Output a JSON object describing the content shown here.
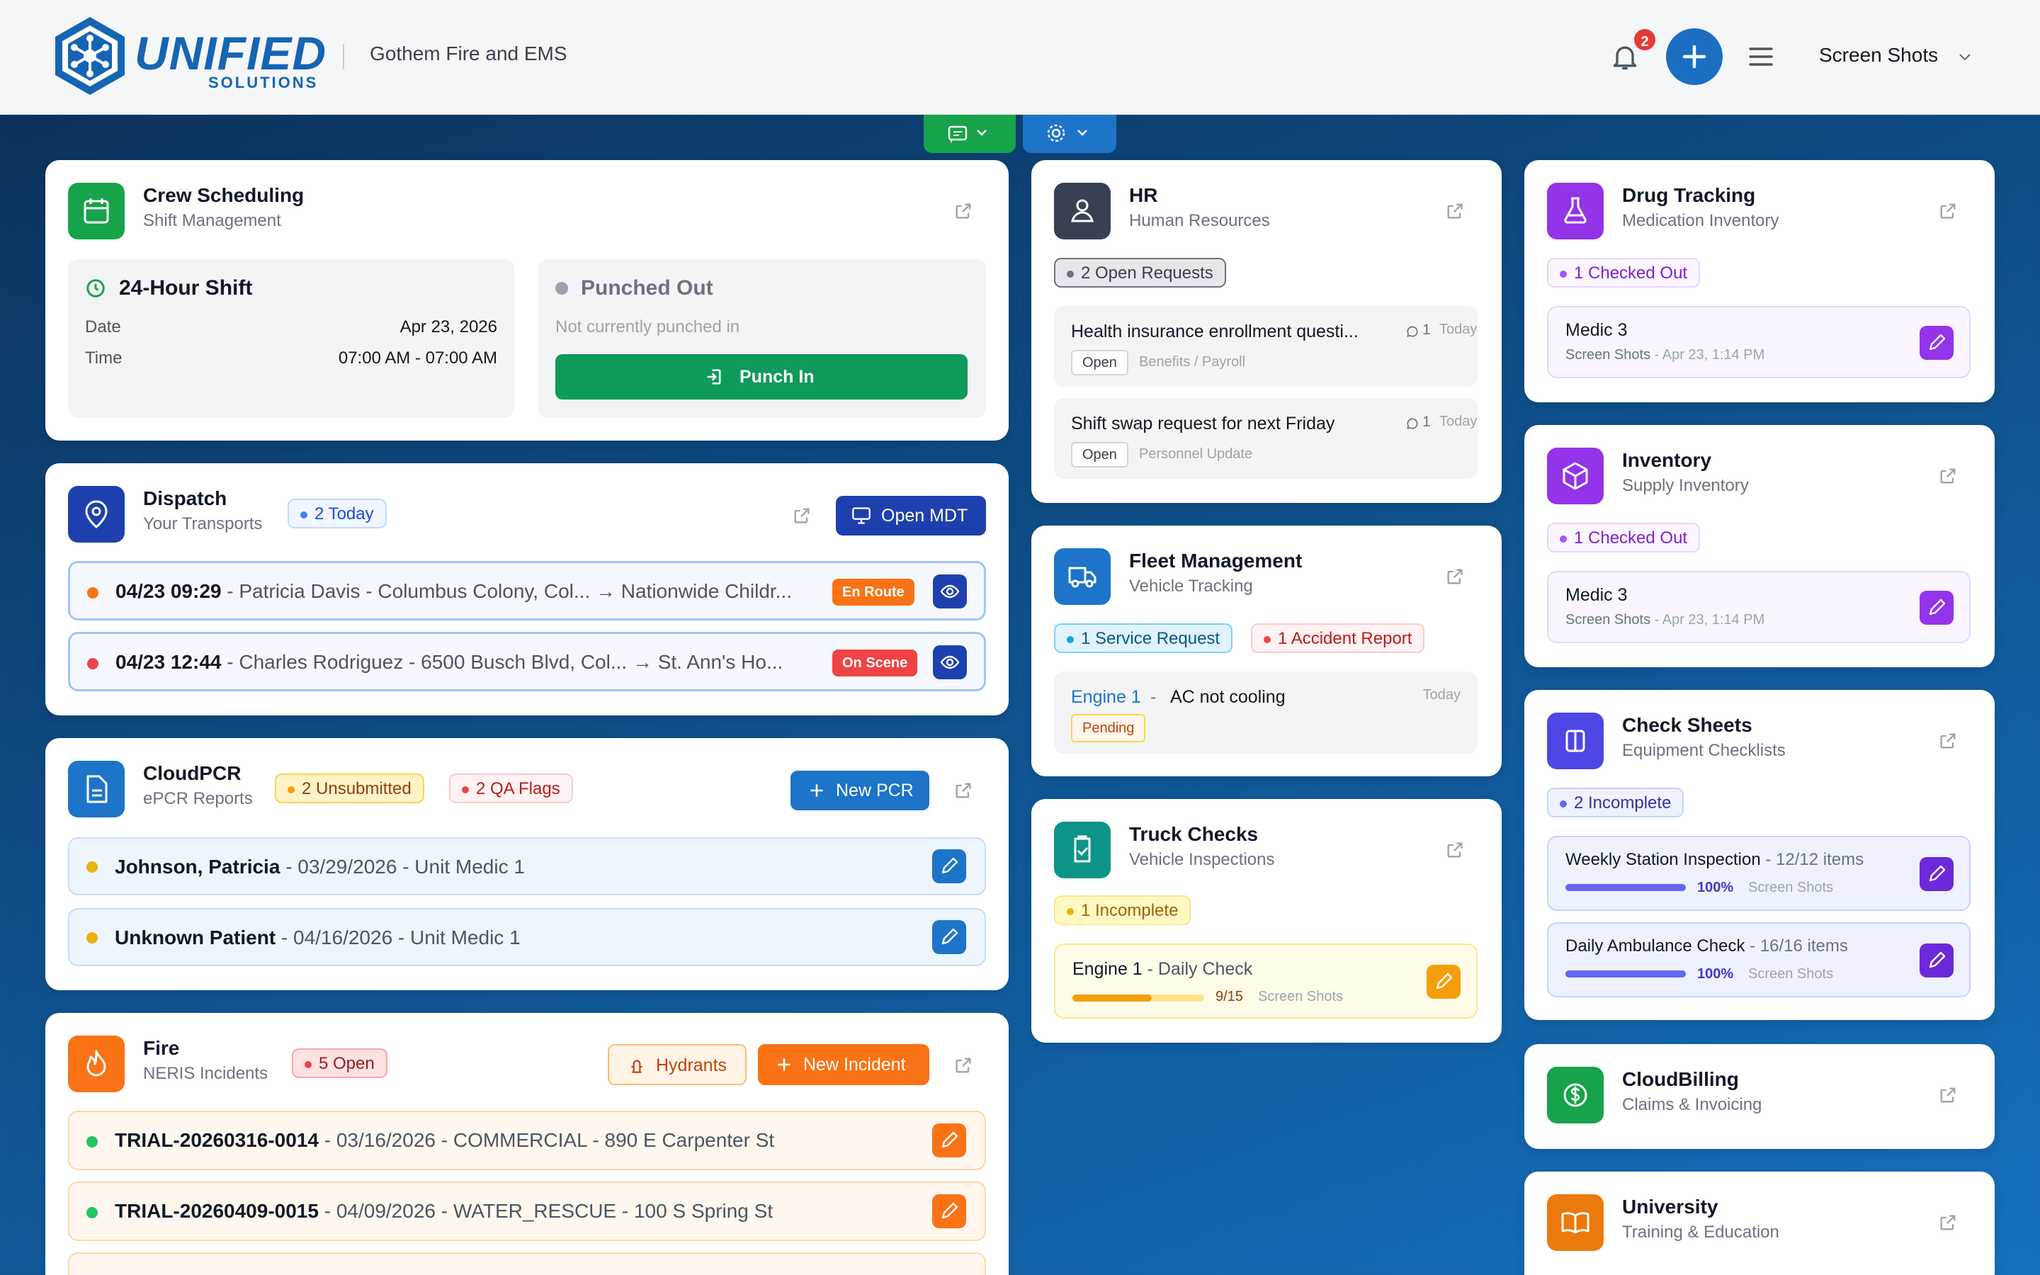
{
  "header": {
    "logo_main": "UNIFIED",
    "logo_sub": "SOLUTIONS",
    "org": "Gothem Fire and EMS",
    "notif_count": "2",
    "user": "Screen Shots"
  },
  "colors": {
    "brand": "#1565b4",
    "green": "#0f9d58",
    "orange": "#f57c00",
    "red": "#e53935",
    "purple": "#8e24aa"
  },
  "crew": {
    "title": "Crew Scheduling",
    "subtitle": "Shift Management",
    "shift": "24-Hour Shift",
    "date_label": "Date",
    "date": "Apr 23, 2026",
    "time_label": "Time",
    "time": "07:00 AM - 07:00 AM",
    "status": "Punched Out",
    "status_note": "Not currently punched in",
    "punch": "Punch In"
  },
  "dispatch": {
    "title": "Dispatch",
    "subtitle": "Your Transports",
    "badge": "2 Today",
    "open_mdt": "Open MDT",
    "rows": [
      {
        "time": "04/23 09:29",
        "desc": "- Patricia Davis - Columbus Colony, Col... → Nationwide Childr...",
        "status": "En Route"
      },
      {
        "time": "04/23 12:44",
        "desc": "- Charles Rodriguez - 6500 Busch Blvd, Col... → St. Ann's Ho...",
        "status": "On Scene"
      }
    ]
  },
  "pcr": {
    "title": "CloudPCR",
    "subtitle": "ePCR Reports",
    "badge1": "2 Unsubmitted",
    "badge2": "2 QA Flags",
    "new": "New PCR",
    "rows": [
      {
        "name": "Johnson, Patricia",
        "desc": "- 03/29/2026 - Unit Medic 1"
      },
      {
        "name": "Unknown Patient",
        "desc": "- 04/16/2026 - Unit Medic 1"
      }
    ]
  },
  "fire": {
    "title": "Fire",
    "subtitle": "NERIS Incidents",
    "badge": "5 Open",
    "hydrants": "Hydrants",
    "new": "New Incident",
    "rows": [
      {
        "id": "TRIAL-20260316-0014",
        "desc": "- 03/16/2026 - COMMERCIAL - 890 E Carpenter St"
      },
      {
        "id": "TRIAL-20260409-0015",
        "desc": "- 04/09/2026 - WATER_RESCUE - 100 S Spring St"
      }
    ]
  },
  "hr": {
    "title": "HR",
    "subtitle": "Human Resources",
    "badge": "2 Open Requests",
    "rows": [
      {
        "title": "Health insurance enrollment questi...",
        "count": "1",
        "when": "Today",
        "status": "Open",
        "cat": "Benefits / Payroll"
      },
      {
        "title": "Shift swap request for next Friday",
        "count": "1",
        "when": "Today",
        "status": "Open",
        "cat": "Personnel Update"
      }
    ]
  },
  "fleet": {
    "title": "Fleet Management",
    "subtitle": "Vehicle Tracking",
    "badge1": "1 Service Request",
    "badge2": "1 Accident Report",
    "unit": "Engine 1",
    "sep": "-",
    "issue": "AC not cooling",
    "when": "Today",
    "status": "Pending"
  },
  "truck": {
    "title": "Truck Checks",
    "subtitle": "Vehicle Inspections",
    "badge": "1 Incomplete",
    "unit": "Engine 1",
    "check": "- Daily Check",
    "progress": "9/15",
    "progress_value": 0.6,
    "by": "Screen Shots"
  },
  "drug": {
    "title": "Drug Tracking",
    "subtitle": "Medication Inventory",
    "badge": "1 Checked Out",
    "unit": "Medic 3",
    "meta": "Screen Shots",
    "date": "- Apr 23, 1:14 PM"
  },
  "inventory": {
    "title": "Inventory",
    "subtitle": "Supply Inventory",
    "badge": "1 Checked Out",
    "unit": "Medic 3",
    "meta": "Screen Shots",
    "date": "- Apr 23, 1:14 PM"
  },
  "checks": {
    "title": "Check Sheets",
    "subtitle": "Equipment Checklists",
    "badge": "2 Incomplete",
    "rows": [
      {
        "name": "Weekly Station Inspection",
        "items": "- 12/12 items",
        "pct": "100%",
        "progress_value": 1,
        "by": "Screen Shots"
      },
      {
        "name": "Daily Ambulance Check",
        "items": "- 16/16 items",
        "pct": "100%",
        "progress_value": 1,
        "by": "Screen Shots"
      }
    ]
  },
  "billing": {
    "title": "CloudBilling",
    "subtitle": "Claims & Invoicing"
  },
  "university": {
    "title": "University",
    "subtitle": "Training & Education"
  }
}
